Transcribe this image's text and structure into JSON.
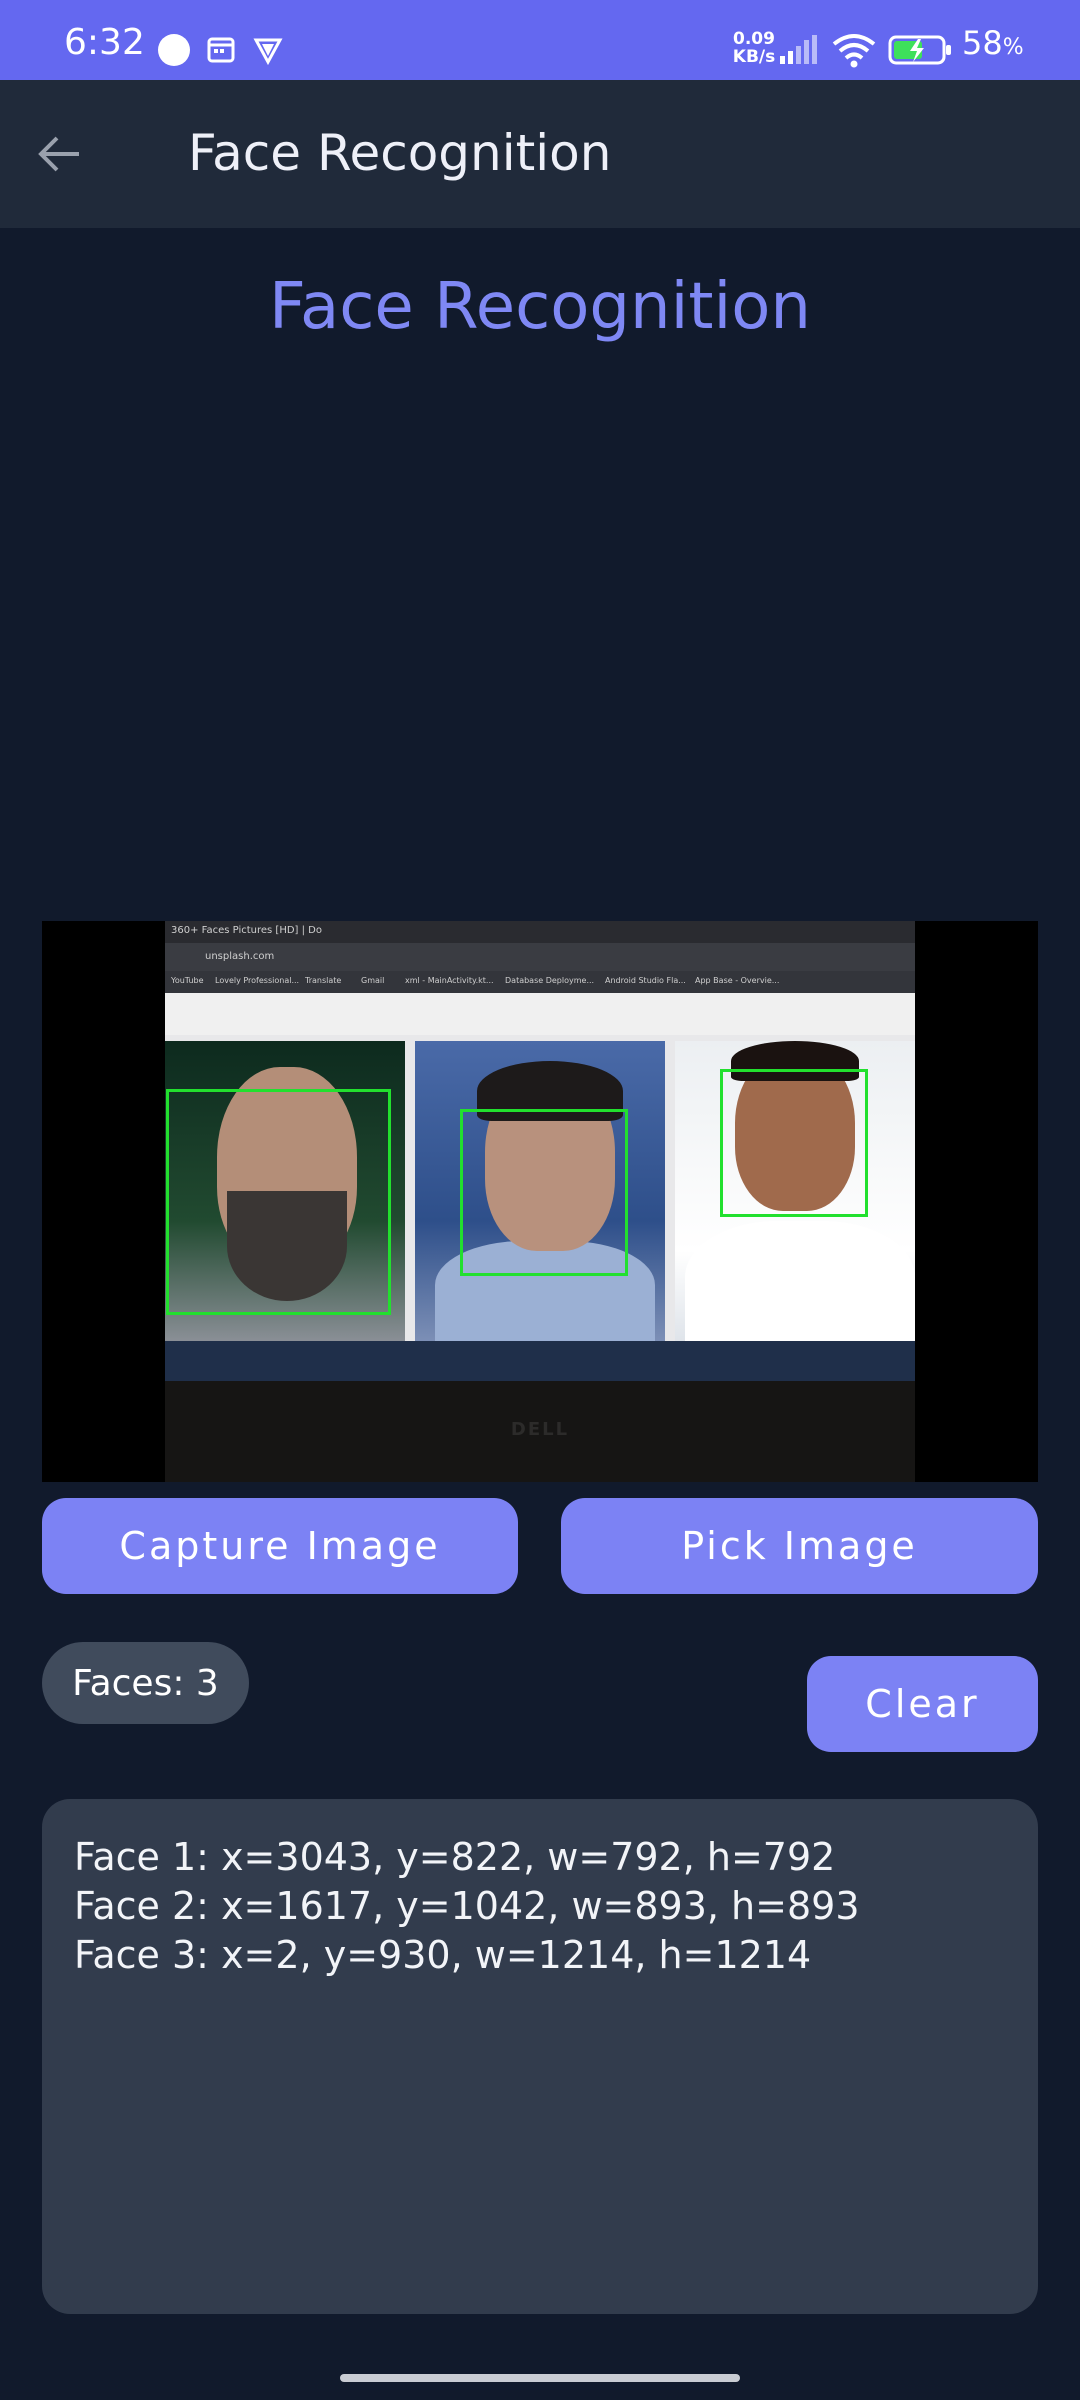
{
  "status_bar": {
    "time": "6:32",
    "net_speed_value": "0.09",
    "net_speed_unit": "KB/s",
    "battery_pct": "58",
    "battery_unit": "%"
  },
  "app_bar": {
    "title": "Face Recognition"
  },
  "page": {
    "heading": "Face Recognition"
  },
  "photo": {
    "tab_text": "360+ Faces Pictures [HD] | Do",
    "url_text": "unsplash.com",
    "bookmarks": [
      "YouTube",
      "Lovely Professional...",
      "Translate",
      "Gmail",
      "xml - MainActivity.kt...",
      "Database Deployme...",
      "Android Studio Fla...",
      "App Base - Overvie..."
    ],
    "laptop_brand": "DELL"
  },
  "actions": {
    "capture_label": "Capture Image",
    "pick_label": "Pick Image",
    "clear_label": "Clear"
  },
  "faces_count": "Faces: 3",
  "results": [
    "Face 1: x=3043, y=822, w=792, h=792",
    "Face 2: x=1617, y=1042, w=893, h=893",
    "Face 3: x=2, y=930, w=1214, h=1214"
  ],
  "colors": {
    "status_bar": "#6468f0",
    "background": "#111a2c",
    "app_bar": "#202a3a",
    "accent": "#7c82f4",
    "heading": "#7f88f4",
    "chip": "#404b5c",
    "results_panel": "#323c4d",
    "face_box": "#22e02e"
  }
}
